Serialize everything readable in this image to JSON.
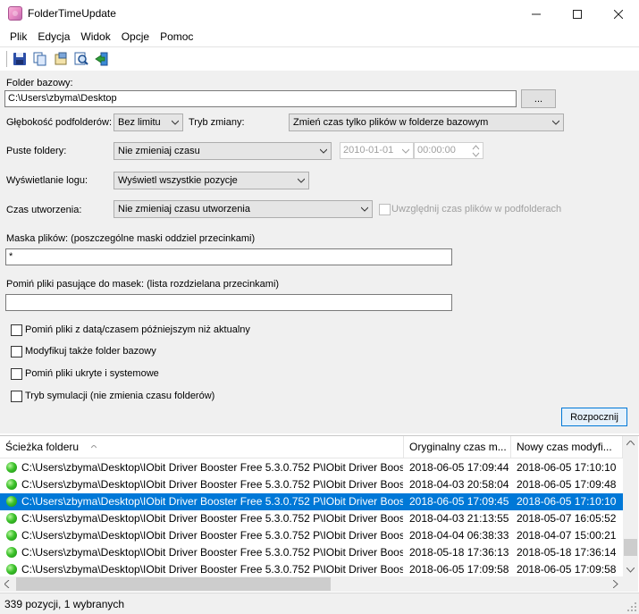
{
  "window": {
    "title": "FolderTimeUpdate",
    "min_symbol": "—",
    "max_symbol": "☐",
    "close_symbol": "✕"
  },
  "menu": [
    "Plik",
    "Edycja",
    "Widok",
    "Opcje",
    "Pomoc"
  ],
  "toolbar": {
    "buttons": [
      "save-icon",
      "copy-icon",
      "properties-icon",
      "find-icon",
      "exit-icon"
    ]
  },
  "form": {
    "base_folder_label": "Folder bazowy:",
    "base_folder_value": "C:\\Users\\zbyma\\Desktop",
    "browse_label": "...",
    "depth_label": "Głębokość podfolderów:",
    "depth_value": "Bez limitu",
    "mode_label": "Tryb zmiany:",
    "mode_value": "Zmień czas tylko plików w folderze bazowym",
    "empty_folders_label": "Puste foldery:",
    "empty_folders_value": "Nie zmieniaj czasu",
    "date_value": "2010-01-01",
    "time_value": "00:00:00",
    "log_label": "Wyświetlanie logu:",
    "log_value": "Wyświetl wszystkie pozycje",
    "created_label": "Czas utworzenia:",
    "created_value": "Nie zmieniaj czasu utworzenia",
    "include_subfolder_files_label": "Uwzględnij czas plików w podfolderach",
    "mask_label": "Maska plików: (poszczególne maski oddziel przecinkami)",
    "mask_value": "*",
    "skip_mask_label": "Pomiń pliki pasujące do masek: (lista rozdzielana przecinkami)",
    "skip_mask_value": "",
    "options": [
      "Pomiń pliki z datą/czasem późniejszym niż aktualny",
      "Modyfikuj także folder bazowy",
      "Pomiń pliki ukryte i systemowe",
      "Tryb symulacji (nie zmienia czasu folderów)"
    ],
    "start_label": "Rozpocznij"
  },
  "list": {
    "columns": [
      "Ścieżka folderu",
      "Oryginalny czas m...",
      "Nowy czas modyfi..."
    ],
    "rows": [
      {
        "path": "C:\\Users\\zbyma\\Desktop\\IObit Driver Booster Free 5.3.0.752 P\\IObit Driver Boos...",
        "orig": "2018-06-05 17:09:44",
        "new": "2018-06-05 17:10:10"
      },
      {
        "path": "C:\\Users\\zbyma\\Desktop\\IObit Driver Booster Free 5.3.0.752 P\\IObit Driver Boos...",
        "orig": "2018-04-03 20:58:04",
        "new": "2018-06-05 17:09:48"
      },
      {
        "path": "C:\\Users\\zbyma\\Desktop\\IObit Driver Booster Free 5.3.0.752 P\\IObit Driver Boos...",
        "orig": "2018-06-05 17:09:45",
        "new": "2018-06-05 17:10:10"
      },
      {
        "path": "C:\\Users\\zbyma\\Desktop\\IObit Driver Booster Free 5.3.0.752 P\\IObit Driver Boos...",
        "orig": "2018-04-03 21:13:55",
        "new": "2018-05-07 16:05:52"
      },
      {
        "path": "C:\\Users\\zbyma\\Desktop\\IObit Driver Booster Free 5.3.0.752 P\\IObit Driver Boos...",
        "orig": "2018-04-04 06:38:33",
        "new": "2018-04-07 15:00:21"
      },
      {
        "path": "C:\\Users\\zbyma\\Desktop\\IObit Driver Booster Free 5.3.0.752 P\\IObit Driver Boos...",
        "orig": "2018-05-18 17:36:13",
        "new": "2018-05-18 17:36:14"
      },
      {
        "path": "C:\\Users\\zbyma\\Desktop\\IObit Driver Booster Free 5.3.0.752 P\\IObit Driver Boos...",
        "orig": "2018-06-05 17:09:58",
        "new": "2018-06-05 17:09:58"
      }
    ],
    "selected_index": 2
  },
  "status": {
    "text": "339 pozycji, 1 wybranych"
  },
  "colors": {
    "selection": "#0078d7",
    "panel": "#f0f0f0"
  }
}
